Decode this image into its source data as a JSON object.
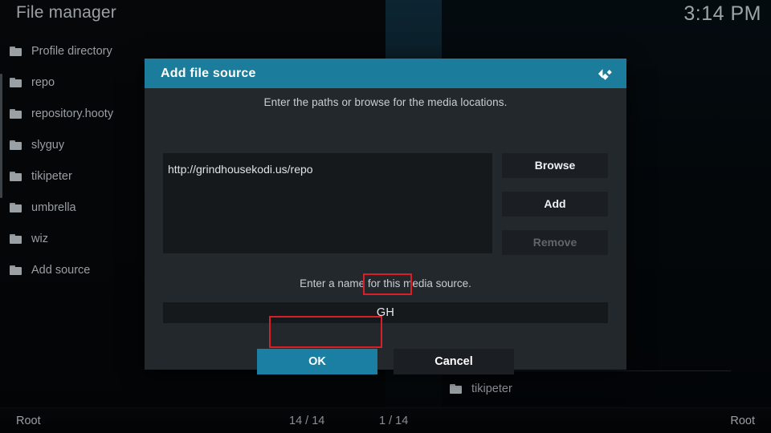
{
  "app": {
    "title": "File manager",
    "clock": "3:14 PM"
  },
  "left_panel": {
    "items": [
      {
        "label": "Profile directory",
        "icon": "folder-icon"
      },
      {
        "label": "repo",
        "icon": "folder-icon"
      },
      {
        "label": "repository.hooty",
        "icon": "folder-icon"
      },
      {
        "label": "slyguy",
        "icon": "folder-icon"
      },
      {
        "label": "tikipeter",
        "icon": "folder-icon"
      },
      {
        "label": "umbrella",
        "icon": "folder-icon"
      },
      {
        "label": "wiz",
        "icon": "folder-icon"
      },
      {
        "label": "Add source",
        "icon": "folder-icon"
      }
    ]
  },
  "right_panel": {
    "items": [
      {
        "label": "tikipeter",
        "icon": "folder-icon"
      }
    ]
  },
  "statusbar": {
    "left_path": "Root",
    "left_count": "14 / 14",
    "right_count": "1 / 14",
    "right_path": "Root"
  },
  "dialog": {
    "title": "Add file source",
    "logo_icon": "kodi-logo-icon",
    "paths_hint": "Enter the paths or browse for the media locations.",
    "paths": [
      "http://grindhousekodi.us/repo"
    ],
    "side_buttons": [
      {
        "label": "Browse",
        "enabled": true
      },
      {
        "label": "Add",
        "enabled": true
      },
      {
        "label": "Remove",
        "enabled": false
      }
    ],
    "name_hint": "Enter a name for this media source.",
    "name_value": "GH",
    "name_placeholder": "",
    "ok_label": "OK",
    "cancel_label": "Cancel"
  },
  "colors": {
    "header_teal": "#1b7d9b",
    "focus_teal": "#1b7fa3",
    "dialog_bg": "#23282c",
    "field_bg": "#16191c",
    "button_bg": "#1b1e22",
    "annotation_red": "#d81f28",
    "text_primary": "#e7eaec",
    "text_muted": "#9a9fa3",
    "text_disabled": "#61666b"
  }
}
